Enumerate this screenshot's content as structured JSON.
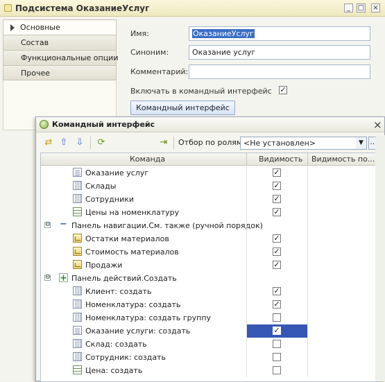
{
  "window": {
    "title": "Подсистема ОказаниеУслуг",
    "controls": {
      "minimize": "_",
      "maximize": "□",
      "close": "×"
    }
  },
  "tabs": [
    "Основные",
    "Состав",
    "Функциональные опции",
    "Прочее"
  ],
  "form": {
    "name_label": "Имя:",
    "name_value": "ОказаниеУслуг",
    "synonym_label": "Синоним:",
    "synonym_value": "Оказание услуг",
    "comment_label": "Комментарий:",
    "comment_value": "",
    "include_label": "Включать в командный интерфейс",
    "include_checked": true,
    "ci_button": "Командный интерфейс"
  },
  "ci": {
    "title": "Командный интерфейс",
    "close": "×",
    "filter_label": "Отбор по ролям:",
    "filter_value": "<Не установлен>",
    "filter_more": "...",
    "columns": [
      "Команда",
      "Видимость",
      "Видимость по..."
    ],
    "rows": [
      {
        "text": "Оказание услуг",
        "icon": "document-icon",
        "level": 1,
        "visible": true
      },
      {
        "text": "Склады",
        "icon": "catalog-icon",
        "level": 1,
        "visible": true
      },
      {
        "text": "Сотрудники",
        "icon": "catalog-icon",
        "level": 1,
        "visible": true
      },
      {
        "text": "Цены на номенклатуру",
        "icon": "register-icon",
        "level": 1,
        "visible": true
      },
      {
        "text": "Панель навигации.См. также (ручной порядок)",
        "icon": "group-icon",
        "level": 0,
        "group": true,
        "expander": "⊖"
      },
      {
        "text": "Остатки материалов",
        "icon": "report-icon",
        "level": 1,
        "visible": true
      },
      {
        "text": "Стоимость материалов",
        "icon": "report-icon",
        "level": 1,
        "visible": true
      },
      {
        "text": "Продажи",
        "icon": "report-icon",
        "level": 1,
        "visible": true
      },
      {
        "text": "Панель действий.Создать",
        "icon": "plus-icon",
        "level": 0,
        "group": true,
        "expander": "⊖"
      },
      {
        "text": "Клиент: создать",
        "icon": "catalog-icon",
        "level": 1,
        "visible": true
      },
      {
        "text": "Номенклатура: создать",
        "icon": "catalog-icon",
        "level": 1,
        "visible": true
      },
      {
        "text": "Номенклатура: создать группу",
        "icon": "catalog-icon",
        "level": 1,
        "visible": false
      },
      {
        "text": "Оказание услуги: создать",
        "icon": "document-icon",
        "level": 1,
        "visible": true,
        "selected": true
      },
      {
        "text": "Склад: создать",
        "icon": "catalog-icon",
        "level": 1,
        "visible": false
      },
      {
        "text": "Сотрудник: создать",
        "icon": "catalog-icon",
        "level": 1,
        "visible": false
      },
      {
        "text": "Цена: создать",
        "icon": "register-icon",
        "level": 1,
        "visible": false
      }
    ]
  }
}
